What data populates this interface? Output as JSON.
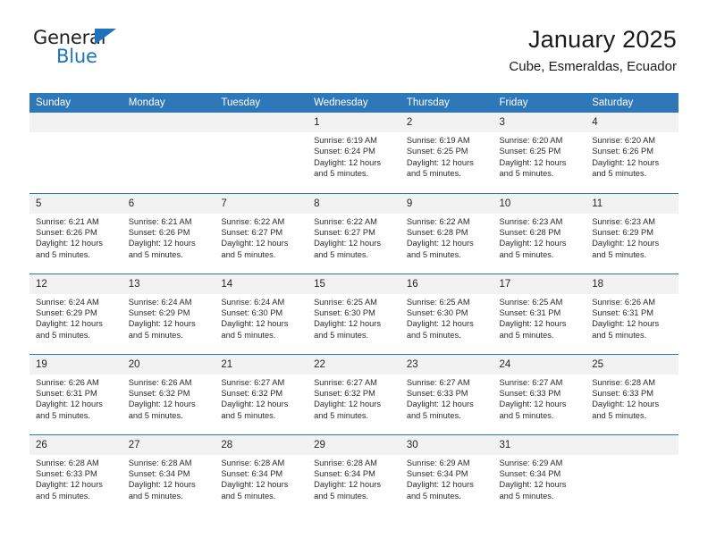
{
  "brand": {
    "name_primary": "General",
    "name_secondary": "Blue",
    "triangle_color": "#1e73bd"
  },
  "header": {
    "title": "January 2025",
    "subtitle": "Cube, Esmeraldas, Ecuador",
    "accent_color": "#2e77b8",
    "daynum_band_color": "#f2f2f2"
  },
  "calendar": {
    "weekday_headers": [
      "Sunday",
      "Monday",
      "Tuesday",
      "Wednesday",
      "Thursday",
      "Friday",
      "Saturday"
    ],
    "labels": {
      "sunrise": "Sunrise:",
      "sunset": "Sunset:",
      "daylight": "Daylight:"
    },
    "weeks": [
      [
        {
          "day": "",
          "empty": true
        },
        {
          "day": "",
          "empty": true
        },
        {
          "day": "",
          "empty": true
        },
        {
          "day": "1",
          "sunrise": "Sunrise: 6:19 AM",
          "sunset": "Sunset: 6:24 PM",
          "daylight_line1": "Daylight: 12 hours",
          "daylight_line2": "and 5 minutes."
        },
        {
          "day": "2",
          "sunrise": "Sunrise: 6:19 AM",
          "sunset": "Sunset: 6:25 PM",
          "daylight_line1": "Daylight: 12 hours",
          "daylight_line2": "and 5 minutes."
        },
        {
          "day": "3",
          "sunrise": "Sunrise: 6:20 AM",
          "sunset": "Sunset: 6:25 PM",
          "daylight_line1": "Daylight: 12 hours",
          "daylight_line2": "and 5 minutes."
        },
        {
          "day": "4",
          "sunrise": "Sunrise: 6:20 AM",
          "sunset": "Sunset: 6:26 PM",
          "daylight_line1": "Daylight: 12 hours",
          "daylight_line2": "and 5 minutes."
        }
      ],
      [
        {
          "day": "5",
          "sunrise": "Sunrise: 6:21 AM",
          "sunset": "Sunset: 6:26 PM",
          "daylight_line1": "Daylight: 12 hours",
          "daylight_line2": "and 5 minutes."
        },
        {
          "day": "6",
          "sunrise": "Sunrise: 6:21 AM",
          "sunset": "Sunset: 6:26 PM",
          "daylight_line1": "Daylight: 12 hours",
          "daylight_line2": "and 5 minutes."
        },
        {
          "day": "7",
          "sunrise": "Sunrise: 6:22 AM",
          "sunset": "Sunset: 6:27 PM",
          "daylight_line1": "Daylight: 12 hours",
          "daylight_line2": "and 5 minutes."
        },
        {
          "day": "8",
          "sunrise": "Sunrise: 6:22 AM",
          "sunset": "Sunset: 6:27 PM",
          "daylight_line1": "Daylight: 12 hours",
          "daylight_line2": "and 5 minutes."
        },
        {
          "day": "9",
          "sunrise": "Sunrise: 6:22 AM",
          "sunset": "Sunset: 6:28 PM",
          "daylight_line1": "Daylight: 12 hours",
          "daylight_line2": "and 5 minutes."
        },
        {
          "day": "10",
          "sunrise": "Sunrise: 6:23 AM",
          "sunset": "Sunset: 6:28 PM",
          "daylight_line1": "Daylight: 12 hours",
          "daylight_line2": "and 5 minutes."
        },
        {
          "day": "11",
          "sunrise": "Sunrise: 6:23 AM",
          "sunset": "Sunset: 6:29 PM",
          "daylight_line1": "Daylight: 12 hours",
          "daylight_line2": "and 5 minutes."
        }
      ],
      [
        {
          "day": "12",
          "sunrise": "Sunrise: 6:24 AM",
          "sunset": "Sunset: 6:29 PM",
          "daylight_line1": "Daylight: 12 hours",
          "daylight_line2": "and 5 minutes."
        },
        {
          "day": "13",
          "sunrise": "Sunrise: 6:24 AM",
          "sunset": "Sunset: 6:29 PM",
          "daylight_line1": "Daylight: 12 hours",
          "daylight_line2": "and 5 minutes."
        },
        {
          "day": "14",
          "sunrise": "Sunrise: 6:24 AM",
          "sunset": "Sunset: 6:30 PM",
          "daylight_line1": "Daylight: 12 hours",
          "daylight_line2": "and 5 minutes."
        },
        {
          "day": "15",
          "sunrise": "Sunrise: 6:25 AM",
          "sunset": "Sunset: 6:30 PM",
          "daylight_line1": "Daylight: 12 hours",
          "daylight_line2": "and 5 minutes."
        },
        {
          "day": "16",
          "sunrise": "Sunrise: 6:25 AM",
          "sunset": "Sunset: 6:30 PM",
          "daylight_line1": "Daylight: 12 hours",
          "daylight_line2": "and 5 minutes."
        },
        {
          "day": "17",
          "sunrise": "Sunrise: 6:25 AM",
          "sunset": "Sunset: 6:31 PM",
          "daylight_line1": "Daylight: 12 hours",
          "daylight_line2": "and 5 minutes."
        },
        {
          "day": "18",
          "sunrise": "Sunrise: 6:26 AM",
          "sunset": "Sunset: 6:31 PM",
          "daylight_line1": "Daylight: 12 hours",
          "daylight_line2": "and 5 minutes."
        }
      ],
      [
        {
          "day": "19",
          "sunrise": "Sunrise: 6:26 AM",
          "sunset": "Sunset: 6:31 PM",
          "daylight_line1": "Daylight: 12 hours",
          "daylight_line2": "and 5 minutes."
        },
        {
          "day": "20",
          "sunrise": "Sunrise: 6:26 AM",
          "sunset": "Sunset: 6:32 PM",
          "daylight_line1": "Daylight: 12 hours",
          "daylight_line2": "and 5 minutes."
        },
        {
          "day": "21",
          "sunrise": "Sunrise: 6:27 AM",
          "sunset": "Sunset: 6:32 PM",
          "daylight_line1": "Daylight: 12 hours",
          "daylight_line2": "and 5 minutes."
        },
        {
          "day": "22",
          "sunrise": "Sunrise: 6:27 AM",
          "sunset": "Sunset: 6:32 PM",
          "daylight_line1": "Daylight: 12 hours",
          "daylight_line2": "and 5 minutes."
        },
        {
          "day": "23",
          "sunrise": "Sunrise: 6:27 AM",
          "sunset": "Sunset: 6:33 PM",
          "daylight_line1": "Daylight: 12 hours",
          "daylight_line2": "and 5 minutes."
        },
        {
          "day": "24",
          "sunrise": "Sunrise: 6:27 AM",
          "sunset": "Sunset: 6:33 PM",
          "daylight_line1": "Daylight: 12 hours",
          "daylight_line2": "and 5 minutes."
        },
        {
          "day": "25",
          "sunrise": "Sunrise: 6:28 AM",
          "sunset": "Sunset: 6:33 PM",
          "daylight_line1": "Daylight: 12 hours",
          "daylight_line2": "and 5 minutes."
        }
      ],
      [
        {
          "day": "26",
          "sunrise": "Sunrise: 6:28 AM",
          "sunset": "Sunset: 6:33 PM",
          "daylight_line1": "Daylight: 12 hours",
          "daylight_line2": "and 5 minutes."
        },
        {
          "day": "27",
          "sunrise": "Sunrise: 6:28 AM",
          "sunset": "Sunset: 6:34 PM",
          "daylight_line1": "Daylight: 12 hours",
          "daylight_line2": "and 5 minutes."
        },
        {
          "day": "28",
          "sunrise": "Sunrise: 6:28 AM",
          "sunset": "Sunset: 6:34 PM",
          "daylight_line1": "Daylight: 12 hours",
          "daylight_line2": "and 5 minutes."
        },
        {
          "day": "29",
          "sunrise": "Sunrise: 6:28 AM",
          "sunset": "Sunset: 6:34 PM",
          "daylight_line1": "Daylight: 12 hours",
          "daylight_line2": "and 5 minutes."
        },
        {
          "day": "30",
          "sunrise": "Sunrise: 6:29 AM",
          "sunset": "Sunset: 6:34 PM",
          "daylight_line1": "Daylight: 12 hours",
          "daylight_line2": "and 5 minutes."
        },
        {
          "day": "31",
          "sunrise": "Sunrise: 6:29 AM",
          "sunset": "Sunset: 6:34 PM",
          "daylight_line1": "Daylight: 12 hours",
          "daylight_line2": "and 5 minutes."
        },
        {
          "day": "",
          "empty": true
        }
      ]
    ]
  }
}
